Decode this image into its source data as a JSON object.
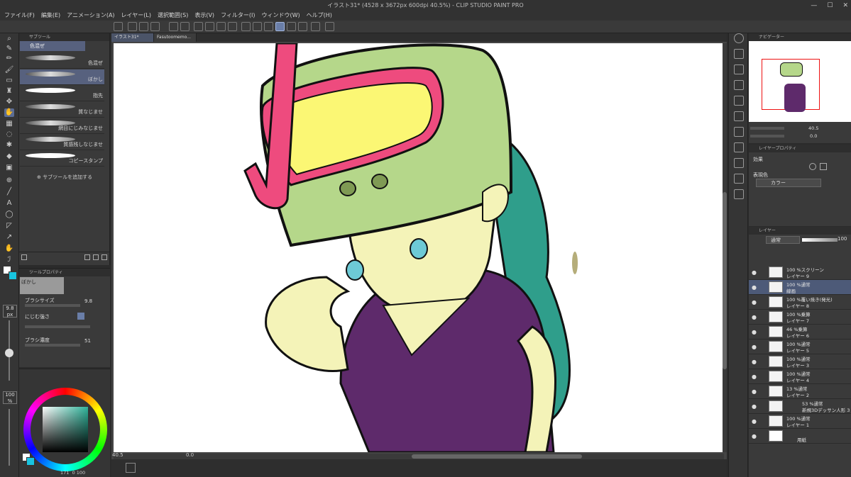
{
  "window": {
    "title": "イラスト31* (4528 x 3672px 600dpi 40.5%)  - CLIP STUDIO PAINT PRO"
  },
  "menu": [
    "ファイル(F)",
    "編集(E)",
    "アニメーション(A)",
    "レイヤー(L)",
    "選択範囲(S)",
    "表示(V)",
    "フィルター(I)",
    "ウィンドウ(W)",
    "ヘルプ(H)"
  ],
  "tabs": [
    {
      "label": "イラスト31*"
    },
    {
      "label": "Fasutoomemo..."
    }
  ],
  "subtool": {
    "header": "サブツール",
    "active_group": "色混ぜ",
    "brushes": [
      {
        "label": "色混ぜ"
      },
      {
        "label": "ぼかし"
      },
      {
        "label": "指先"
      },
      {
        "label": "質なじませ"
      },
      {
        "label": "網目にじみなじませ"
      },
      {
        "label": "質感残しなじませ"
      },
      {
        "label": "コピースタンプ"
      }
    ],
    "add_label": "サブツールを追加する"
  },
  "toolprop": {
    "header": "ツールプロパティ",
    "name": "ぼかし",
    "brush_size_label": "ブラシサイズ",
    "brush_size": "9.8",
    "blend_label": "にじむ強さ",
    "density_label": "ブラシ濃度",
    "density": "51"
  },
  "left_readouts": {
    "size": "9.8",
    "size_unit": "px",
    "opacity": "100",
    "opacity_unit": "%"
  },
  "color": {
    "main": "#ffffff",
    "sub": "#18c4e0",
    "hue": "#2fb39a",
    "readout_a": "171",
    "readout_b": "0",
    "readout_c": "100"
  },
  "status": {
    "zoom": "40.5",
    "angle": "0.0"
  },
  "navigator": {
    "header": "ナビゲーター",
    "zoom": "40.5",
    "angle": "0.0"
  },
  "layerprop": {
    "header": "レイヤープロパティ",
    "effect_label": "効果",
    "expression_label": "表現色",
    "expression_value": "カラー"
  },
  "layers": {
    "header": "レイヤー",
    "blend_mode": "通常",
    "opacity": "100",
    "rows": [
      {
        "mode": "100 %スクリーン",
        "name": "レイヤー 9"
      },
      {
        "mode": "100 %通常",
        "name": "線画"
      },
      {
        "mode": "100 %覆い焼き(発光)",
        "name": "レイヤー 8"
      },
      {
        "mode": "100 %乗算",
        "name": "レイヤー 7"
      },
      {
        "mode": "46 %乗算",
        "name": "レイヤー 6"
      },
      {
        "mode": "100 %通常",
        "name": "レイヤー 5"
      },
      {
        "mode": "100 %通常",
        "name": "レイヤー 3"
      },
      {
        "mode": "100 %通常",
        "name": "レイヤー 4"
      },
      {
        "mode": "13 %通常",
        "name": "レイヤー 2"
      },
      {
        "mode": "53 %通常",
        "name": "新規3Dデッサン人形 3"
      },
      {
        "mode": "100 %通常",
        "name": "レイヤー 1"
      },
      {
        "mode": "",
        "name": "用紙"
      }
    ]
  }
}
